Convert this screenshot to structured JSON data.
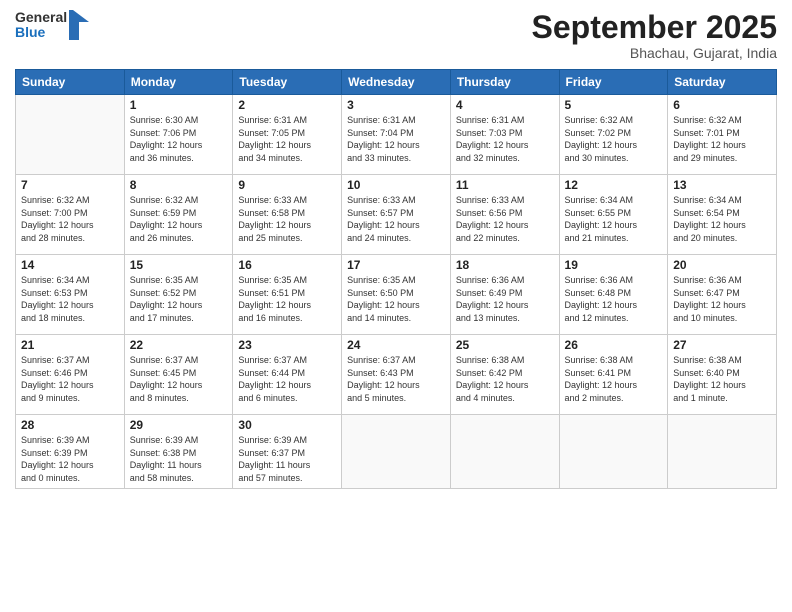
{
  "logo": {
    "general": "General",
    "blue": "Blue"
  },
  "header": {
    "month": "September 2025",
    "location": "Bhachau, Gujarat, India"
  },
  "days_of_week": [
    "Sunday",
    "Monday",
    "Tuesday",
    "Wednesday",
    "Thursday",
    "Friday",
    "Saturday"
  ],
  "weeks": [
    [
      {
        "day": "",
        "info": ""
      },
      {
        "day": "1",
        "info": "Sunrise: 6:30 AM\nSunset: 7:06 PM\nDaylight: 12 hours\nand 36 minutes."
      },
      {
        "day": "2",
        "info": "Sunrise: 6:31 AM\nSunset: 7:05 PM\nDaylight: 12 hours\nand 34 minutes."
      },
      {
        "day": "3",
        "info": "Sunrise: 6:31 AM\nSunset: 7:04 PM\nDaylight: 12 hours\nand 33 minutes."
      },
      {
        "day": "4",
        "info": "Sunrise: 6:31 AM\nSunset: 7:03 PM\nDaylight: 12 hours\nand 32 minutes."
      },
      {
        "day": "5",
        "info": "Sunrise: 6:32 AM\nSunset: 7:02 PM\nDaylight: 12 hours\nand 30 minutes."
      },
      {
        "day": "6",
        "info": "Sunrise: 6:32 AM\nSunset: 7:01 PM\nDaylight: 12 hours\nand 29 minutes."
      }
    ],
    [
      {
        "day": "7",
        "info": "Sunrise: 6:32 AM\nSunset: 7:00 PM\nDaylight: 12 hours\nand 28 minutes."
      },
      {
        "day": "8",
        "info": "Sunrise: 6:32 AM\nSunset: 6:59 PM\nDaylight: 12 hours\nand 26 minutes."
      },
      {
        "day": "9",
        "info": "Sunrise: 6:33 AM\nSunset: 6:58 PM\nDaylight: 12 hours\nand 25 minutes."
      },
      {
        "day": "10",
        "info": "Sunrise: 6:33 AM\nSunset: 6:57 PM\nDaylight: 12 hours\nand 24 minutes."
      },
      {
        "day": "11",
        "info": "Sunrise: 6:33 AM\nSunset: 6:56 PM\nDaylight: 12 hours\nand 22 minutes."
      },
      {
        "day": "12",
        "info": "Sunrise: 6:34 AM\nSunset: 6:55 PM\nDaylight: 12 hours\nand 21 minutes."
      },
      {
        "day": "13",
        "info": "Sunrise: 6:34 AM\nSunset: 6:54 PM\nDaylight: 12 hours\nand 20 minutes."
      }
    ],
    [
      {
        "day": "14",
        "info": "Sunrise: 6:34 AM\nSunset: 6:53 PM\nDaylight: 12 hours\nand 18 minutes."
      },
      {
        "day": "15",
        "info": "Sunrise: 6:35 AM\nSunset: 6:52 PM\nDaylight: 12 hours\nand 17 minutes."
      },
      {
        "day": "16",
        "info": "Sunrise: 6:35 AM\nSunset: 6:51 PM\nDaylight: 12 hours\nand 16 minutes."
      },
      {
        "day": "17",
        "info": "Sunrise: 6:35 AM\nSunset: 6:50 PM\nDaylight: 12 hours\nand 14 minutes."
      },
      {
        "day": "18",
        "info": "Sunrise: 6:36 AM\nSunset: 6:49 PM\nDaylight: 12 hours\nand 13 minutes."
      },
      {
        "day": "19",
        "info": "Sunrise: 6:36 AM\nSunset: 6:48 PM\nDaylight: 12 hours\nand 12 minutes."
      },
      {
        "day": "20",
        "info": "Sunrise: 6:36 AM\nSunset: 6:47 PM\nDaylight: 12 hours\nand 10 minutes."
      }
    ],
    [
      {
        "day": "21",
        "info": "Sunrise: 6:37 AM\nSunset: 6:46 PM\nDaylight: 12 hours\nand 9 minutes."
      },
      {
        "day": "22",
        "info": "Sunrise: 6:37 AM\nSunset: 6:45 PM\nDaylight: 12 hours\nand 8 minutes."
      },
      {
        "day": "23",
        "info": "Sunrise: 6:37 AM\nSunset: 6:44 PM\nDaylight: 12 hours\nand 6 minutes."
      },
      {
        "day": "24",
        "info": "Sunrise: 6:37 AM\nSunset: 6:43 PM\nDaylight: 12 hours\nand 5 minutes."
      },
      {
        "day": "25",
        "info": "Sunrise: 6:38 AM\nSunset: 6:42 PM\nDaylight: 12 hours\nand 4 minutes."
      },
      {
        "day": "26",
        "info": "Sunrise: 6:38 AM\nSunset: 6:41 PM\nDaylight: 12 hours\nand 2 minutes."
      },
      {
        "day": "27",
        "info": "Sunrise: 6:38 AM\nSunset: 6:40 PM\nDaylight: 12 hours\nand 1 minute."
      }
    ],
    [
      {
        "day": "28",
        "info": "Sunrise: 6:39 AM\nSunset: 6:39 PM\nDaylight: 12 hours\nand 0 minutes."
      },
      {
        "day": "29",
        "info": "Sunrise: 6:39 AM\nSunset: 6:38 PM\nDaylight: 11 hours\nand 58 minutes."
      },
      {
        "day": "30",
        "info": "Sunrise: 6:39 AM\nSunset: 6:37 PM\nDaylight: 11 hours\nand 57 minutes."
      },
      {
        "day": "",
        "info": ""
      },
      {
        "day": "",
        "info": ""
      },
      {
        "day": "",
        "info": ""
      },
      {
        "day": "",
        "info": ""
      }
    ]
  ]
}
